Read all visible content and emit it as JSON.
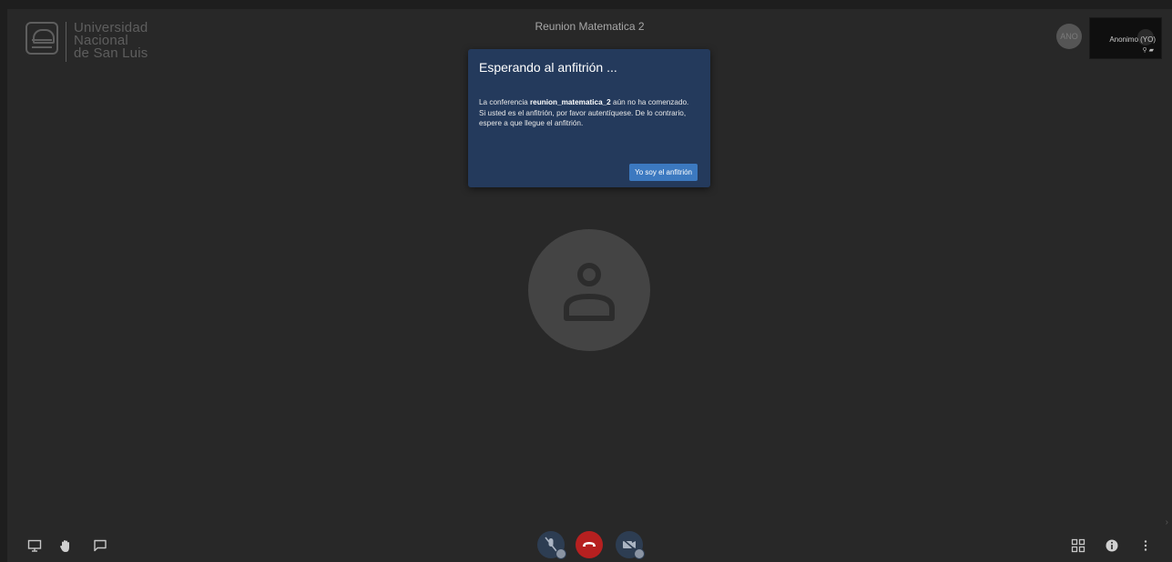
{
  "logo": {
    "lines": [
      "Universidad",
      "Nacional",
      "de San Luis"
    ]
  },
  "meeting": {
    "title": "Reunion Matematica 2"
  },
  "self_view": {
    "avatar_initials": "ANO",
    "name": "Anonimo (YO)"
  },
  "dialog": {
    "title": "Esperando al anfitrión ...",
    "body_prefix": "La conferencia ",
    "conference_name": "reunion_matematica_2",
    "body_suffix": " aún no ha comenzado. Si usted es el anfitrión, por favor autentíquese. De lo contrario, espere a que llegue el anfitrión.",
    "host_button": "Yo soy el anfitrión"
  },
  "toolbar": {
    "left": [
      "screen-share-icon",
      "raise-hand-icon",
      "chat-icon"
    ],
    "center": [
      "microphone-muted-icon",
      "hangup-icon",
      "camera-off-icon"
    ],
    "right": [
      "tile-view-icon",
      "info-icon",
      "more-options-icon"
    ]
  },
  "colors": {
    "background": "#282828",
    "dialog": "#243a5c",
    "primary_button": "#3c79c0",
    "hangup": "#b62020"
  }
}
